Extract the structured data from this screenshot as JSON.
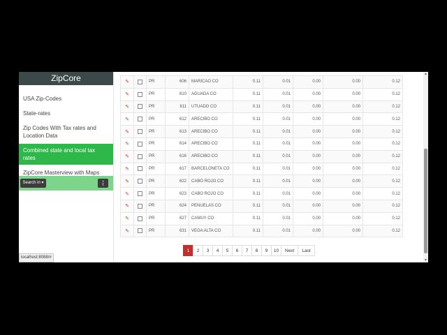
{
  "sidebar": {
    "brand": "ZipCore",
    "items": [
      {
        "label": "USA Zip-Codes"
      },
      {
        "label": "State-rates"
      },
      {
        "label": "Zip Codes With Tax rates and Location Data"
      },
      {
        "label": "Combined state and local tax rates",
        "active": true
      },
      {
        "label": "ZipCore Masterview with Maps"
      }
    ],
    "search_label": "Search in ▾",
    "menu_icon": "kebab-icon"
  },
  "status_url": "localhost:8088/#",
  "table": {
    "rows": [
      [
        "PR",
        "606",
        "MARICAO CO",
        "0.11",
        "0.01",
        "0.00",
        "0.00",
        "0.12"
      ],
      [
        "PR",
        "610",
        "AGUADA CO",
        "0.11",
        "0.01",
        "0.00",
        "0.00",
        "0.12"
      ],
      [
        "PR",
        "611",
        "UTUADO CO",
        "0.11",
        "0.01",
        "0.00",
        "0.00",
        "0.12"
      ],
      [
        "PR",
        "612",
        "ARECIBO CO",
        "0.11",
        "0.01",
        "0.00",
        "0.00",
        "0.12"
      ],
      [
        "PR",
        "613",
        "ARECIBO CO",
        "0.11",
        "0.01",
        "0.00",
        "0.00",
        "0.12"
      ],
      [
        "PR",
        "614",
        "ARECIBO CO",
        "0.11",
        "0.01",
        "0.00",
        "0.00",
        "0.12"
      ],
      [
        "PR",
        "616",
        "ARECIBO CO",
        "0.11",
        "0.01",
        "0.00",
        "0.00",
        "0.12"
      ],
      [
        "PR",
        "617",
        "BARCELONETA CO",
        "0.11",
        "0.01",
        "0.00",
        "0.00",
        "0.12"
      ],
      [
        "PR",
        "622",
        "CABO ROJO CO",
        "0.11",
        "0.01",
        "0.00",
        "0.00",
        "0.12"
      ],
      [
        "PR",
        "623",
        "CABO ROJO CO",
        "0.11",
        "0.01",
        "0.00",
        "0.00",
        "0.12"
      ],
      [
        "PR",
        "624",
        "PENUELAS CO",
        "0.11",
        "0.01",
        "0.00",
        "0.00",
        "0.12"
      ],
      [
        "PR",
        "627",
        "CAMUY CO",
        "0.11",
        "0.01",
        "0.00",
        "0.00",
        "0.12"
      ],
      [
        "PR",
        "631",
        "VEGA ALTA CO",
        "0.11",
        "0.01",
        "0.00",
        "0.00",
        "0.12"
      ]
    ]
  },
  "pagination": {
    "pages": [
      "1",
      "2",
      "3",
      "4",
      "5",
      "6",
      "7",
      "8",
      "9",
      "10"
    ],
    "active": "1",
    "next": "Next",
    "last": "Last"
  },
  "colors": {
    "accent": "#2fb84a",
    "active_page": "#c0302e",
    "header": "#3b4a48"
  }
}
